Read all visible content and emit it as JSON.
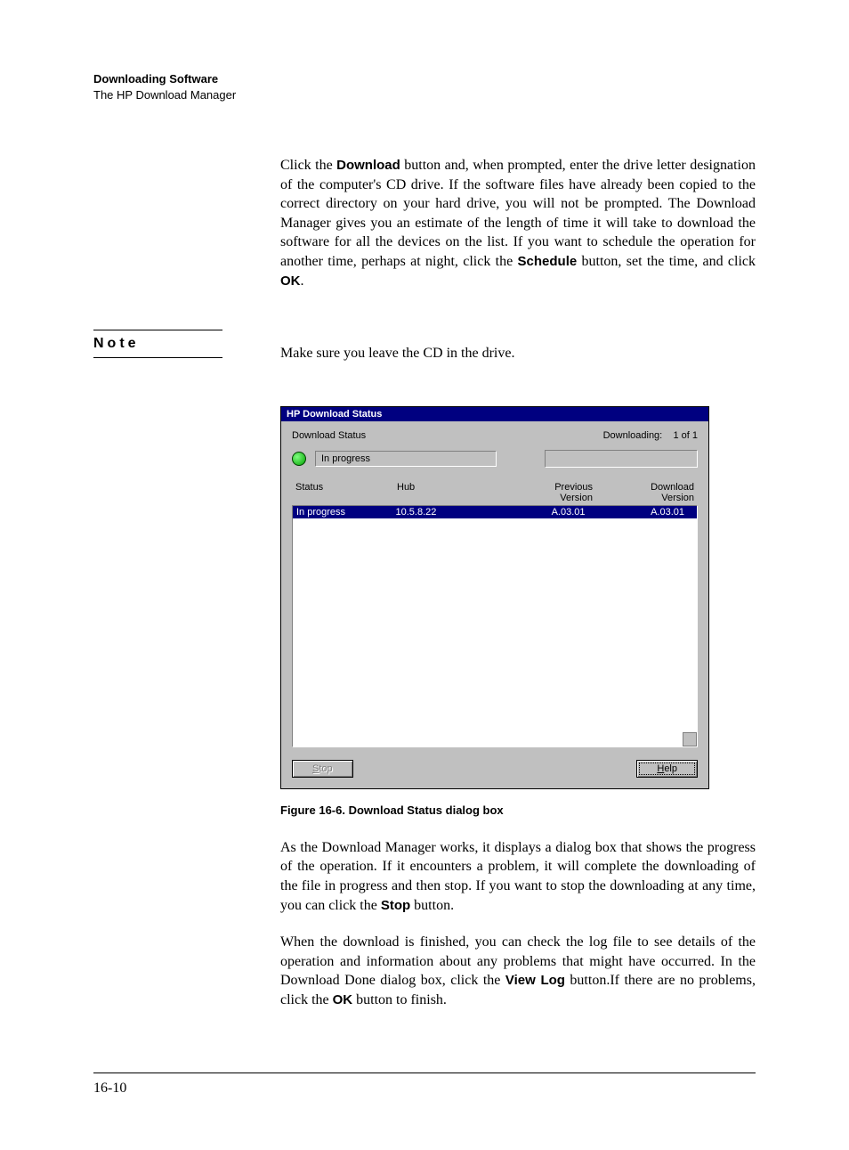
{
  "header": {
    "title": "Downloading Software",
    "subtitle": "The HP Download Manager"
  },
  "para1": {
    "t1": "Click the ",
    "b1": "Download",
    "t2": " button and, when prompted, enter the drive letter designation of the computer's CD drive. If the software files have already been copied to the correct directory on your hard drive, you will not be prompted. The Download Manager gives you an estimate of the length of time it will take to download the software for all the devices on the list. If you want to schedule the operation for another time, perhaps at night, click the ",
    "b2": "Schedule",
    "t3": " button, set the time, and click ",
    "b3": "OK",
    "t4": "."
  },
  "note": {
    "label": "Note",
    "text": "Make sure you leave the CD in the drive."
  },
  "dialog": {
    "title": "HP Download Status",
    "status_label": "Download Status",
    "downloading_label": "Downloading:",
    "downloading_value": "1 of 1",
    "overall_status": "In progress",
    "columns": {
      "c1": "Status",
      "c2": "Hub",
      "c3": "Previous\nVersion",
      "c4": "Download\nVersion"
    },
    "row": {
      "status": "In progress",
      "hub": "10.5.8.22",
      "prev": "A.03.01",
      "dl": "A.03.01"
    },
    "buttons": {
      "stop": "Stop",
      "help": "Help"
    }
  },
  "caption": "Figure 16-6.  Download Status dialog box",
  "para2": {
    "t1": "As the Download Manager works, it displays a dialog box that shows the progress of the operation. If it encounters a problem, it will complete the downloading of the file in progress and then stop. If you want to stop the downloading at any time, you can click the ",
    "b1": "Stop",
    "t2": " button."
  },
  "para3": {
    "t1": "When the download is finished, you can check the log file to see details of the operation and information about any problems that might have occurred. In the Download Done dialog box, click the ",
    "b1": "View Log",
    "t2": " button.If there are no problems, click the ",
    "b2": "OK",
    "t3": " button to finish."
  },
  "page_number": "16-10"
}
